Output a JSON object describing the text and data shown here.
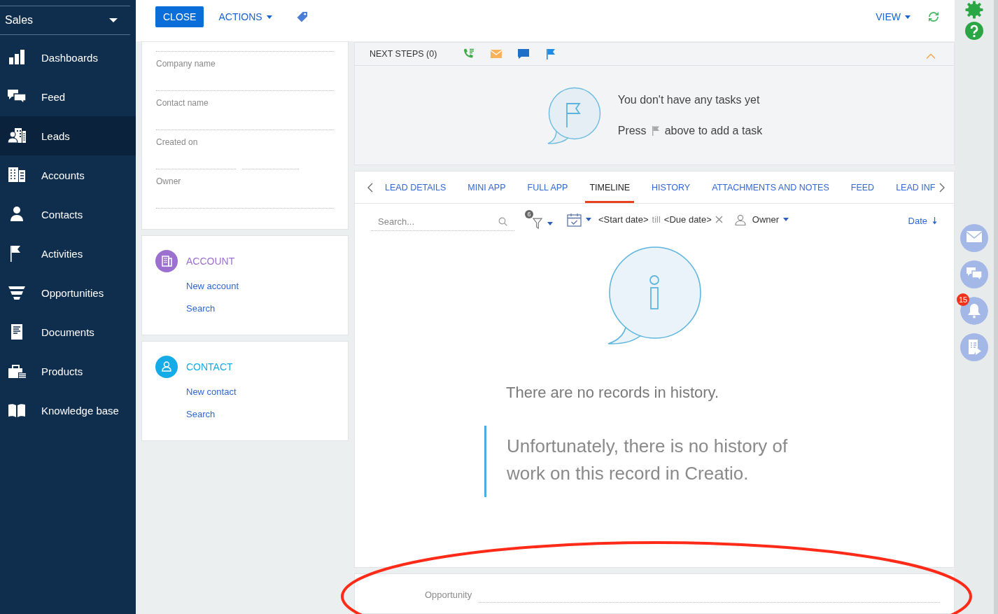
{
  "sidebar": {
    "workplace": "Sales",
    "items": [
      {
        "label": "Dashboards",
        "selected": false
      },
      {
        "label": "Feed",
        "selected": false
      },
      {
        "label": "Leads",
        "selected": true
      },
      {
        "label": "Accounts",
        "selected": false
      },
      {
        "label": "Contacts",
        "selected": false
      },
      {
        "label": "Activities",
        "selected": false
      },
      {
        "label": "Opportunities",
        "selected": false
      },
      {
        "label": "Documents",
        "selected": false
      },
      {
        "label": "Products",
        "selected": false
      },
      {
        "label": "Knowledge base",
        "selected": false
      }
    ]
  },
  "toolbar": {
    "close": "CLOSE",
    "actions": "ACTIONS",
    "view": "VIEW"
  },
  "lead_fields": [
    {
      "kind": "text",
      "label": "Company name"
    },
    {
      "kind": "text",
      "label": "Contact name"
    },
    {
      "kind": "date_range",
      "label": "Created on"
    },
    {
      "kind": "text",
      "label": "Owner"
    }
  ],
  "quick_cards": [
    {
      "title": "ACCOUNT",
      "color": "#9b70cf",
      "links": [
        "New account",
        "Search"
      ]
    },
    {
      "title": "CONTACT",
      "color": "#14abe6",
      "links": [
        "New contact",
        "Search"
      ]
    }
  ],
  "next_steps": {
    "title": "NEXT STEPS (0)",
    "expanded": true,
    "empty_title": "You don't have any tasks yet",
    "hint_before": "Press",
    "hint_after": "above to add a task"
  },
  "tabs": [
    {
      "label": "LEAD DETAILS",
      "selected": false
    },
    {
      "label": "MINI APP",
      "selected": false
    },
    {
      "label": "FULL APP",
      "selected": false
    },
    {
      "label": "TIMELINE",
      "selected": true
    },
    {
      "label": "HISTORY",
      "selected": false
    },
    {
      "label": "ATTACHMENTS AND NOTES",
      "selected": false
    },
    {
      "label": "FEED",
      "selected": false
    },
    {
      "label": "LEAD INF",
      "selected": false
    }
  ],
  "filters": {
    "search": {
      "placeholder": "Search..."
    },
    "filter_count": "6",
    "start_date": "<Start date>",
    "till": "till",
    "due_date": "<Due date>",
    "owner": "Owner",
    "sort": "Date"
  },
  "history": {
    "message": "There are no records in history.",
    "note": "Unfortunately, there is no history of work on this record in Creatio."
  },
  "bottom_field": {
    "label": "Opportunity"
  },
  "side_actions": [
    {
      "kind": "email"
    },
    {
      "kind": "chat"
    },
    {
      "kind": "notifications",
      "badge": "15"
    },
    {
      "kind": "process"
    }
  ],
  "annotation": {
    "kind": "ellipse"
  }
}
